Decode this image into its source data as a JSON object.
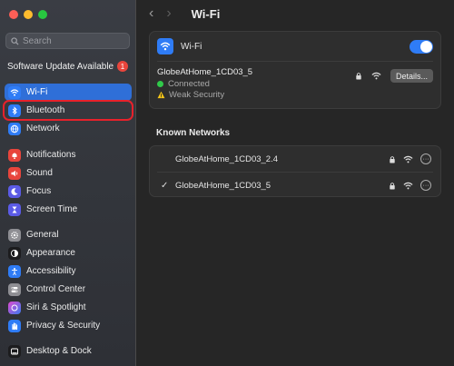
{
  "sidebar": {
    "search_placeholder": "Search",
    "update": {
      "label": "Software Update Available",
      "badge": "1"
    },
    "items": [
      {
        "id": "wifi",
        "label": "Wi-Fi",
        "icon": "wifi-icon",
        "color": "#2f7cf6"
      },
      {
        "id": "bluetooth",
        "label": "Bluetooth",
        "icon": "bluetooth-icon",
        "color": "#2f7cf6"
      },
      {
        "id": "network",
        "label": "Network",
        "icon": "globe-icon",
        "color": "#2f7cf6"
      },
      {
        "id": "notifications",
        "label": "Notifications",
        "icon": "bell-icon",
        "color": "#e8453c"
      },
      {
        "id": "sound",
        "label": "Sound",
        "icon": "speaker-icon",
        "color": "#e8453c"
      },
      {
        "id": "focus",
        "label": "Focus",
        "icon": "moon-icon",
        "color": "#5b5be6"
      },
      {
        "id": "screen-time",
        "label": "Screen Time",
        "icon": "hourglass-icon",
        "color": "#5b5be6"
      },
      {
        "id": "general",
        "label": "General",
        "icon": "gear-icon",
        "color": "#8e8e93"
      },
      {
        "id": "appearance",
        "label": "Appearance",
        "icon": "appearance-icon",
        "color": "#1c1c1e"
      },
      {
        "id": "accessibility",
        "label": "Accessibility",
        "icon": "accessibility-icon",
        "color": "#2f7cf6"
      },
      {
        "id": "control-center",
        "label": "Control Center",
        "icon": "toggles-icon",
        "color": "#8e8e93"
      },
      {
        "id": "siri",
        "label": "Siri & Spotlight",
        "icon": "siri-icon",
        "color": "#3a3a3c"
      },
      {
        "id": "privacy",
        "label": "Privacy & Security",
        "icon": "hand-icon",
        "color": "#2f7cf6"
      },
      {
        "id": "desktop-dock",
        "label": "Desktop & Dock",
        "icon": "dock-icon",
        "color": "#1c1c1e"
      }
    ]
  },
  "header": {
    "title": "Wi-Fi"
  },
  "wifi_card": {
    "label": "Wi-Fi",
    "enabled": true,
    "current": {
      "ssid": "GlobeAtHome_1CD03_5",
      "status": "Connected",
      "warning": "Weak Security",
      "details_label": "Details..."
    }
  },
  "known_networks": {
    "title": "Known Networks",
    "items": [
      {
        "ssid": "GlobeAtHome_1CD03_2.4",
        "checked": false,
        "more": "···"
      },
      {
        "ssid": "GlobeAtHome_1CD03_5",
        "checked": true,
        "check": "✓",
        "more": "···"
      }
    ]
  },
  "colors": {
    "accent": "#2f7cf6",
    "connected": "#30c94a",
    "warning": "#f5c518",
    "highlight": "#e8212b"
  }
}
